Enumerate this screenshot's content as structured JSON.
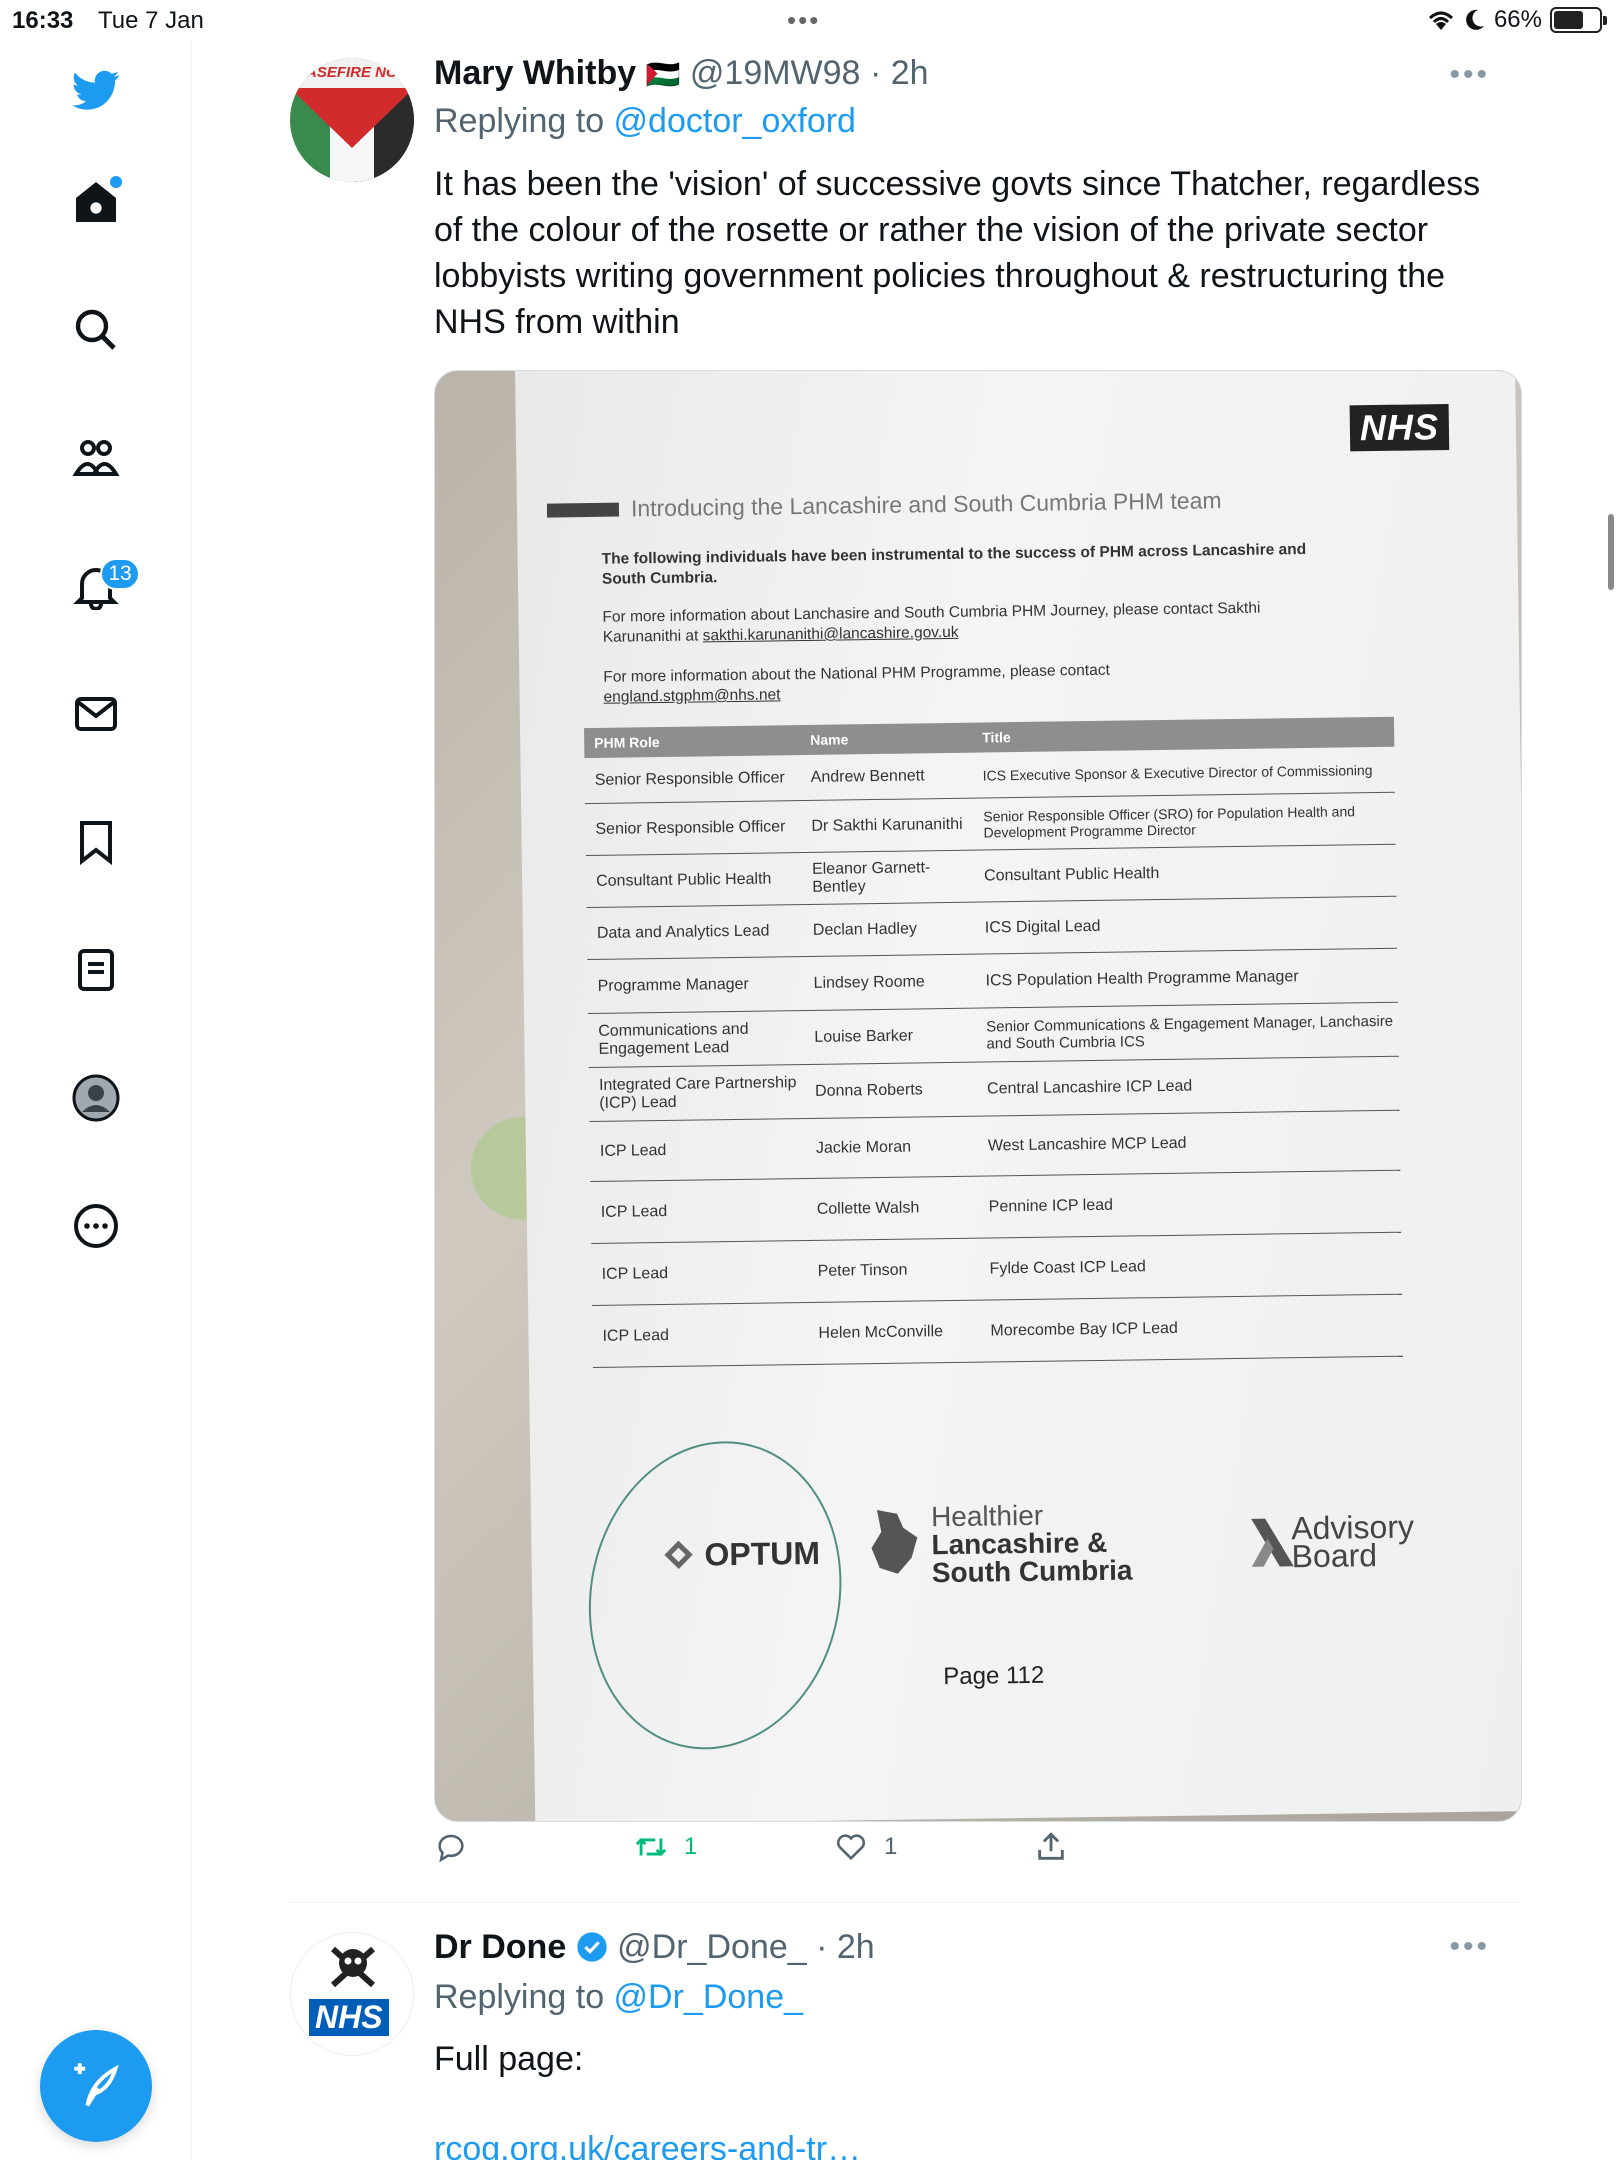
{
  "status_bar": {
    "time": "16:33",
    "date": "Tue 7 Jan",
    "battery": "66%",
    "battery_level": 0.66
  },
  "sidebar": {
    "notifications_badge": "13"
  },
  "tweet1": {
    "name": "Mary Whitby",
    "flag": "🇵🇸",
    "handle": "@19MW98",
    "time": "· 2h",
    "replying_prefix": "Replying to ",
    "replying_to": "@doctor_oxford",
    "text": "It has been the 'vision' of successive govts since Thatcher, regardless of the colour of the rosette or rather the vision of the private sector lobbyists writing government policies throughout & restructuring the NHS from within",
    "avatar_text": "ASEFIRE NC",
    "retweets": "1",
    "likes": "1"
  },
  "document": {
    "nhs": "NHS",
    "heading": "Introducing the Lancashire and South Cumbria PHM team",
    "para1": "The following individuals have been instrumental to the success of PHM across Lancashire and South Cumbria.",
    "para2_text": "For more information about Lanchasire and South Cumbria PHM Journey, please contact Sakthi Karunanithi at ",
    "para2_email": "sakthi.karunanithi@lancashire.gov.uk",
    "para3_text": "For more information about the National PHM Programme, please contact ",
    "para3_email": "england.stgphm@nhs.net",
    "columns": [
      "PHM Role",
      "Name",
      "Title"
    ],
    "rows": [
      [
        "Senior Responsible Officer",
        "Andrew Bennett",
        "ICS Executive Sponsor & Executive Director of Commissioning"
      ],
      [
        "Senior Responsible Officer",
        "Dr Sakthi Karunanithi",
        "Senior Responsible Officer (SRO) for Population Health and Development Programme Director"
      ],
      [
        "Consultant Public Health",
        "Eleanor Garnett-Bentley",
        "Consultant Public Health"
      ],
      [
        "Data and Analytics Lead",
        "Declan Hadley",
        "ICS Digital Lead"
      ],
      [
        "Programme Manager",
        "Lindsey Roome",
        "ICS Population Health Programme Manager"
      ],
      [
        "Communications and Engagement Lead",
        "Louise Barker",
        "Senior Communications & Engagement Manager, Lanchasire and South Cumbria ICS"
      ],
      [
        "Integrated Care Partnership (ICP) Lead",
        "Donna Roberts",
        "Central Lancashire ICP Lead"
      ],
      [
        "ICP Lead",
        "Jackie Moran",
        "West Lancashire MCP Lead"
      ],
      [
        "ICP Lead",
        "Collette Walsh",
        "Pennine ICP lead"
      ],
      [
        "ICP Lead",
        "Peter Tinson",
        "Fylde Coast ICP Lead"
      ],
      [
        "ICP Lead",
        "Helen McConville",
        "Morecombe Bay ICP Lead"
      ]
    ],
    "optum": "OPTUM",
    "hlsc_line1": "Healthier",
    "hlsc_line2": "Lancashire &",
    "hlsc_line3": "South Cumbria",
    "advisory_line1": "Advisory",
    "advisory_line2": "Board",
    "page": "Page 112"
  },
  "tweet2": {
    "name": "Dr Done",
    "handle": "@Dr_Done_",
    "time": "· 2h",
    "replying_prefix": "Replying to ",
    "replying_to": "@Dr_Done_",
    "text": "Full page:",
    "link": "rcog.org.uk/careers-and-tr…",
    "avatar_text": "NHS"
  },
  "colors": {
    "accent": "#1d9bf0",
    "retweet": "#00ba7c",
    "secondary": "#536471"
  }
}
